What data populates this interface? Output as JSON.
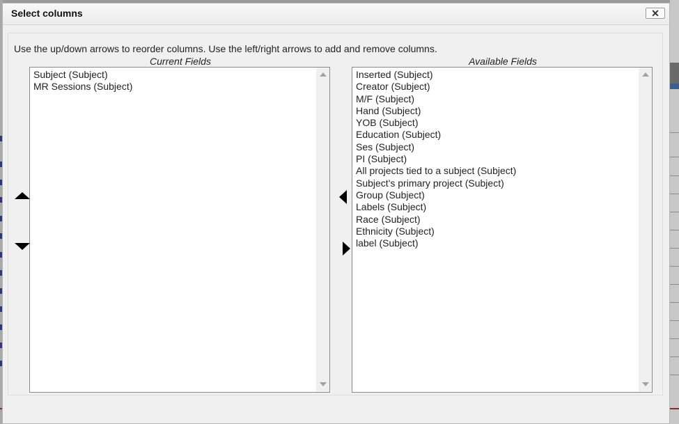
{
  "dialog": {
    "title": "Select columns",
    "close_label": "✕",
    "instructions": "Use the up/down arrows to reorder columns. Use the left/right arrows to add and remove columns."
  },
  "current_fields": {
    "caption": "Current Fields",
    "items": [
      "Subject (Subject)",
      "MR Sessions (Subject)"
    ]
  },
  "available_fields": {
    "caption": "Available Fields",
    "items": [
      "Inserted (Subject)",
      "Creator (Subject)",
      "M/F (Subject)",
      "Hand (Subject)",
      "YOB (Subject)",
      "Education (Subject)",
      "Ses (Subject)",
      "PI (Subject)",
      "All projects tied to a subject (Subject)",
      "Subject's primary project (Subject)",
      "Group (Subject)",
      "Labels (Subject)",
      "Race (Subject)",
      "Ethnicity (Subject)",
      "label (Subject)"
    ]
  }
}
